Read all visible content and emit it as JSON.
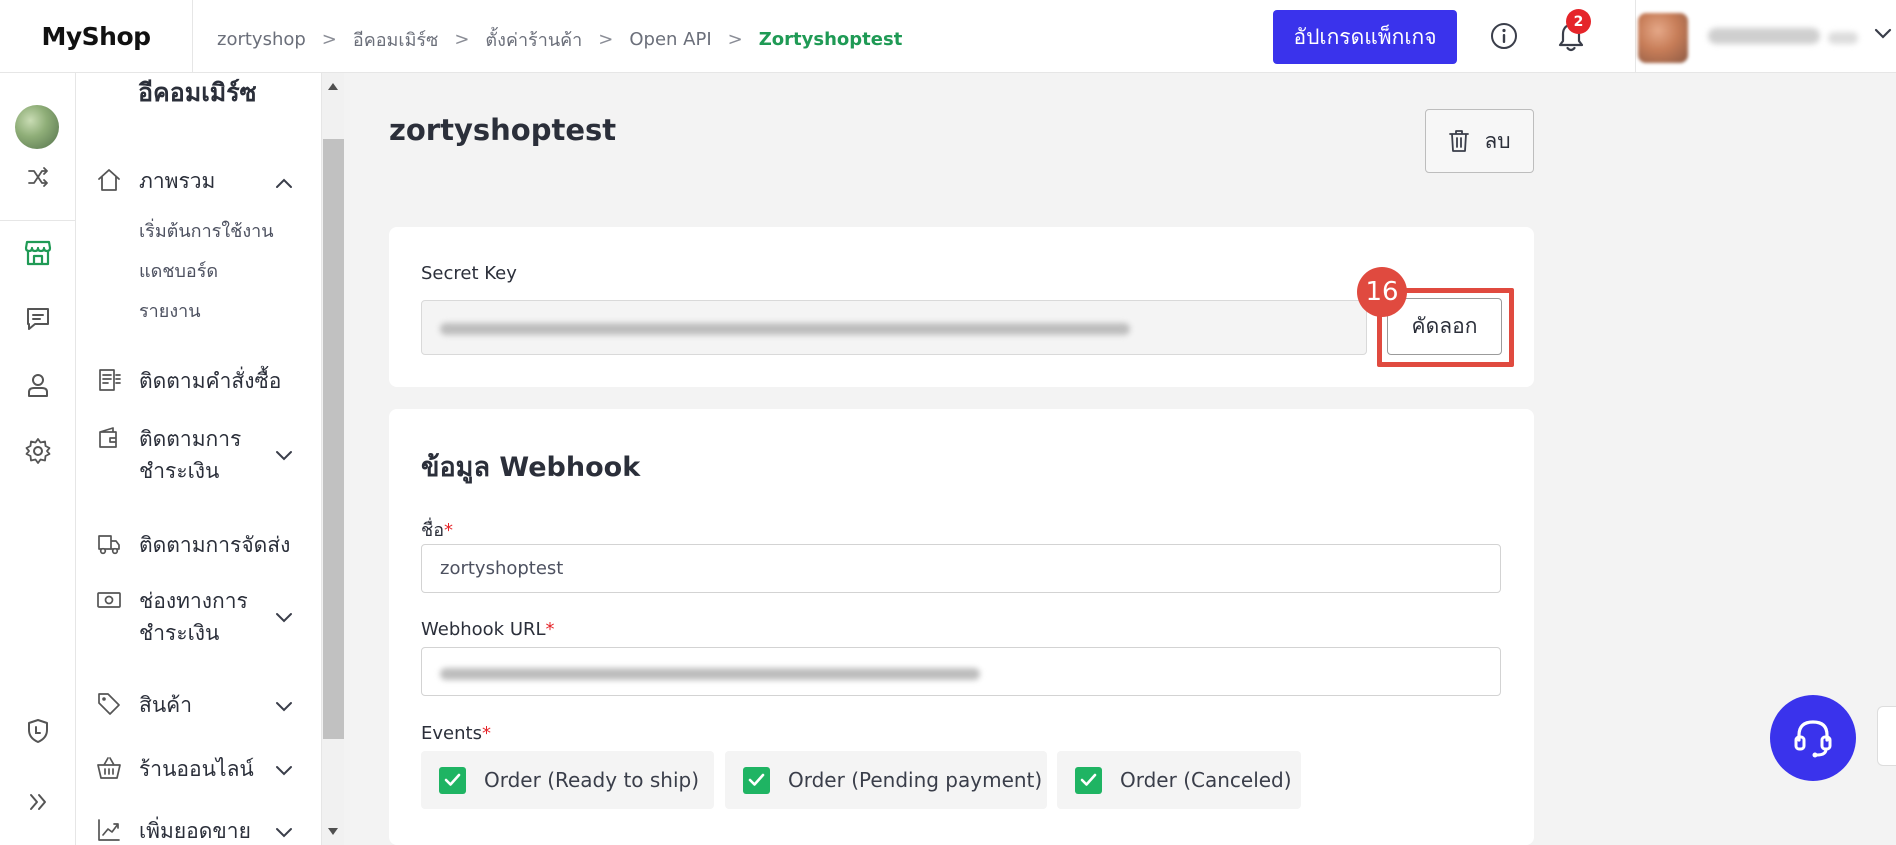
{
  "app": {
    "brand": "MyShop"
  },
  "breadcrumb": [
    "zortyshop",
    "อีคอมเมิร์ซ",
    "ตั้งค่าร้านค้า",
    "Open API",
    "Zortyshoptest"
  ],
  "breadcrumb_sep": ">",
  "topbar": {
    "upgrade_label": "อัปเกรดแพ็กเกจ",
    "notification_count": "2",
    "info_icon": "info-icon",
    "bell_icon": "bell-icon"
  },
  "rail": {
    "icons": [
      "shuffle-icon",
      "store-icon",
      "chat-icon",
      "user-icon",
      "gear-icon",
      "shield-icon",
      "double-chevron-right-icon"
    ],
    "active": "store-icon",
    "active_color": "#1f9a55"
  },
  "sidebar": {
    "title": "อีคอมเมิร์ซ",
    "overview_label": "ภาพรวม",
    "overview_sub": [
      "เริ่มต้นการใช้งาน",
      "แดชบอร์ด",
      "รายงาน"
    ],
    "orders_label": "ติดตามคำสั่งซื้อ",
    "payments_label_1": "ติดตามการ",
    "payments_label_2": "ชำระเงิน",
    "shipping_label": "ติดตามการจัดส่ง",
    "channels_label_1": "ช่องทางการ",
    "channels_label_2": "ชำระเงิน",
    "products_label": "สินค้า",
    "online_store_label": "ร้านออนไลน์",
    "boost_label": "เพิ่มยอดขาย"
  },
  "main": {
    "title": "zortyshoptest",
    "delete_label": "ลบ",
    "secret_key_label": "Secret Key",
    "copy_label": "คัดลอก",
    "step_number": "16",
    "webhook_title": "ข้อมูล Webhook",
    "name_label": "ชื่อ",
    "name_value": "zortyshoptest",
    "url_label": "Webhook URL",
    "events_label": "Events",
    "required_mark": "*",
    "events": [
      "Order (Ready to ship)",
      "Order (Pending payment)",
      "Order (Canceled)"
    ]
  },
  "colors": {
    "accent": "#3a33ec",
    "success": "#1fb463",
    "highlight": "#e04a3f",
    "badge": "#e5252a"
  }
}
